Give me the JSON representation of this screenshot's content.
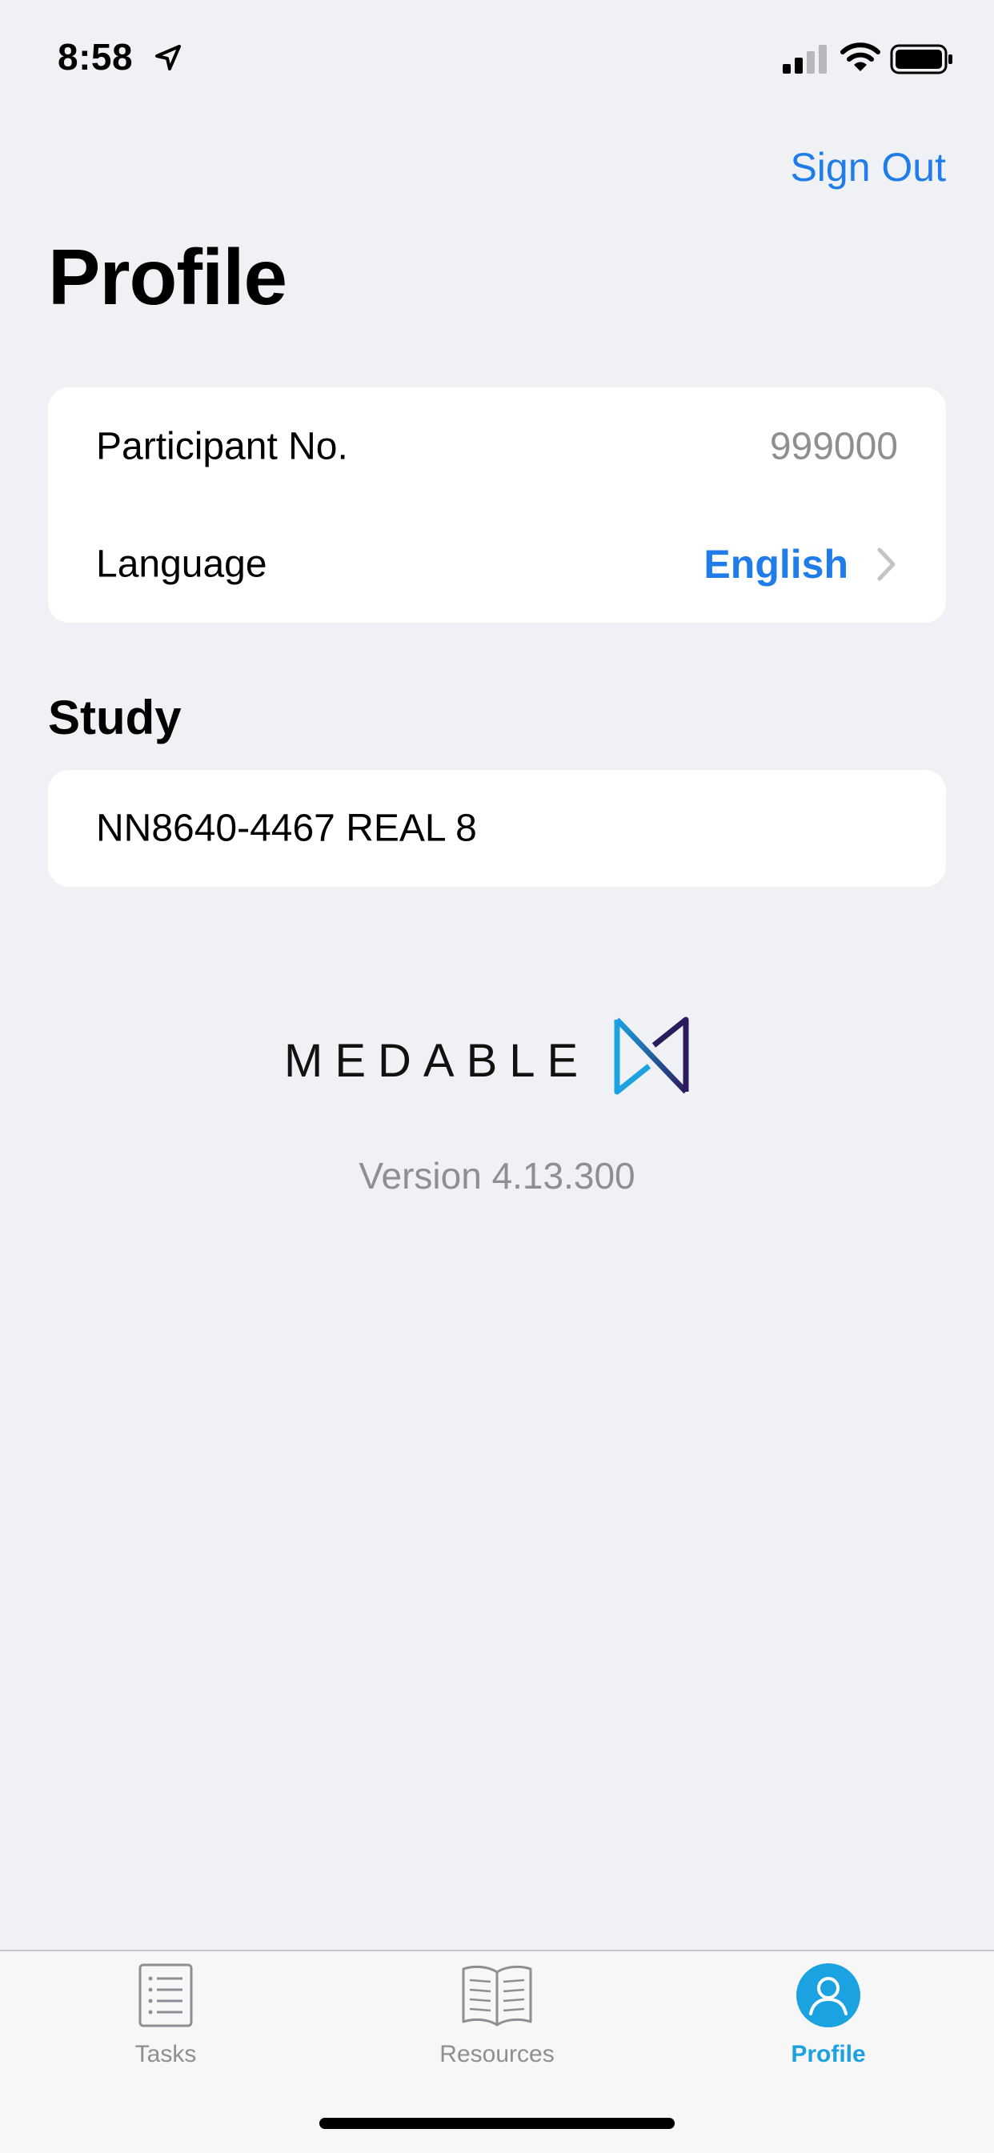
{
  "status_bar": {
    "time": "8:58",
    "icons": [
      "location-arrow-icon",
      "cellular-signal-icon",
      "wifi-icon",
      "battery-icon"
    ]
  },
  "nav": {
    "sign_out_label": "Sign Out"
  },
  "page": {
    "title": "Profile"
  },
  "profile_card": {
    "participant": {
      "label": "Participant No.",
      "value": "999000"
    },
    "language": {
      "label": "Language",
      "value": "English"
    }
  },
  "study_section": {
    "title": "Study",
    "study_name": "NN8640-4467 REAL 8"
  },
  "branding": {
    "logo_text": "MEDABLE",
    "version": "Version 4.13.300"
  },
  "tab_bar": {
    "tabs": [
      {
        "label": "Tasks",
        "icon": "checklist-icon",
        "active": false
      },
      {
        "label": "Resources",
        "icon": "open-book-icon",
        "active": false
      },
      {
        "label": "Profile",
        "icon": "person-icon",
        "active": true
      }
    ]
  },
  "colors": {
    "background": "#F0F1F5",
    "card": "#FFFFFF",
    "link_blue": "#1F7CE8",
    "active_tab": "#1BA2E0",
    "secondary_text": "#8E8E93"
  }
}
